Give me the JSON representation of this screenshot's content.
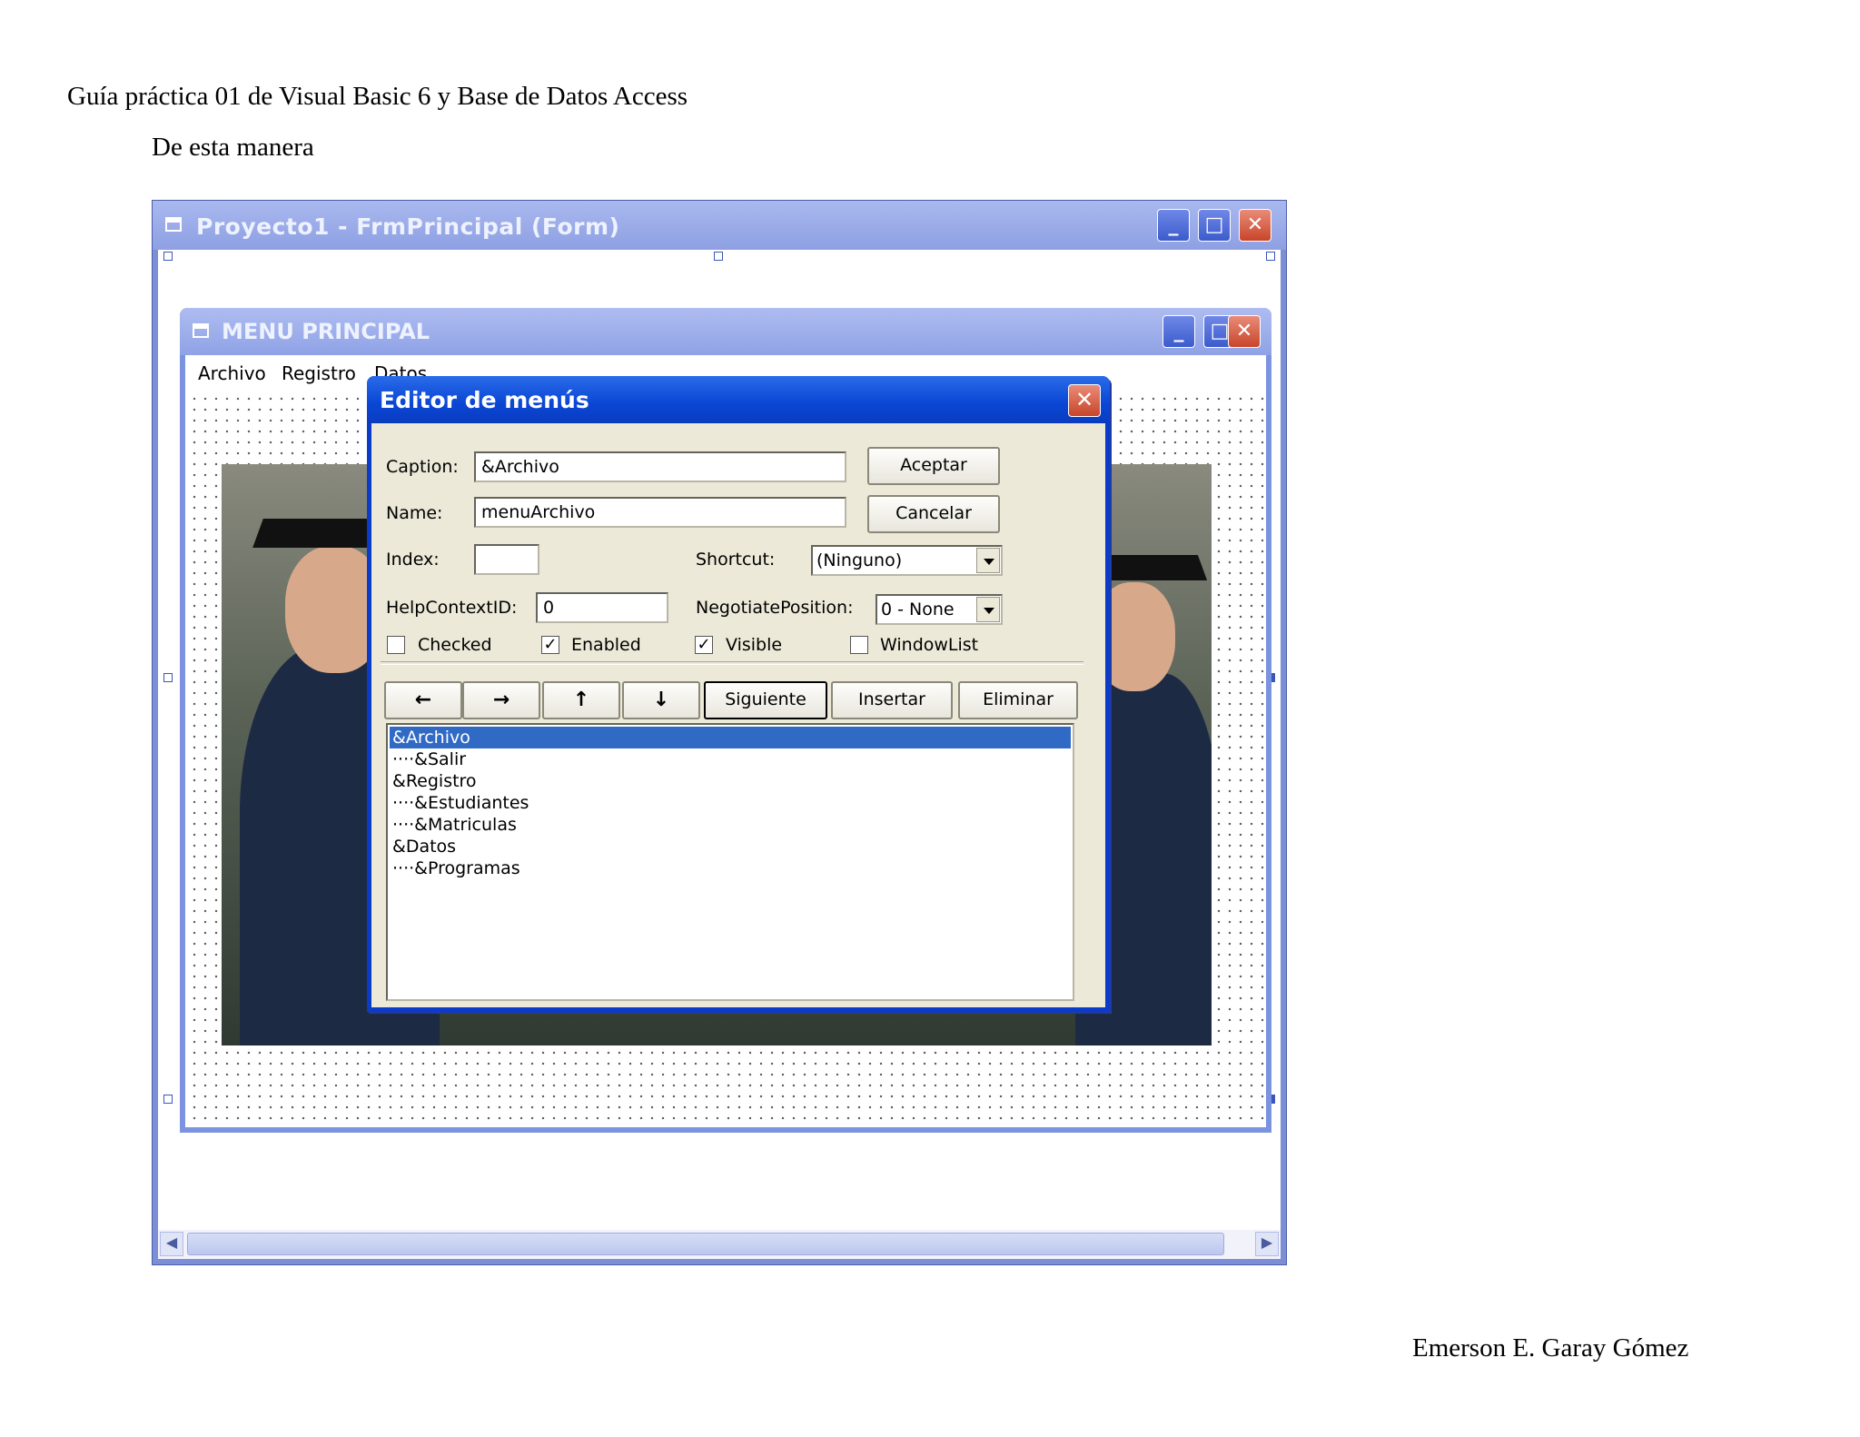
{
  "document": {
    "header": "Guía práctica 01 de Visual Basic 6 y Base de Datos Access",
    "subtitle": "De esta manera",
    "author": "Emerson E. Garay Gómez"
  },
  "ide_window": {
    "title": "Proyecto1 - FrmPrincipal (Form)",
    "buttons": [
      "minimize-icon",
      "maximize-icon",
      "close-icon"
    ]
  },
  "form_window": {
    "title": "MENU PRINCIPAL",
    "menu": [
      "Archivo",
      "Registro",
      "Datos"
    ]
  },
  "menu_editor": {
    "title": "Editor de menús",
    "caption_label": "Caption:",
    "caption_value": "&Archivo",
    "name_label": "Name:",
    "name_value": "menuArchivo",
    "index_label": "Index:",
    "index_value": "",
    "shortcut_label": "Shortcut:",
    "shortcut_value": "(Ninguno)",
    "helpcontext_label": "HelpContextID:",
    "helpcontext_value": "0",
    "negotiate_label": "NegotiatePosition:",
    "negotiate_value": "0 - None",
    "accept": "Aceptar",
    "cancel": "Cancelar",
    "checkboxes": [
      {
        "label": "Checked",
        "checked": false
      },
      {
        "label": "Enabled",
        "checked": true
      },
      {
        "label": "Visible",
        "checked": true
      },
      {
        "label": "WindowList",
        "checked": false
      }
    ],
    "arrow_buttons": [
      "arrow-left-icon",
      "arrow-right-icon",
      "arrow-up-icon",
      "arrow-down-icon"
    ],
    "next": "Siguiente",
    "insert": "Insertar",
    "delete": "Eliminar",
    "items": [
      "&Archivo",
      "····&Salir",
      "&Registro",
      "····&Estudiantes",
      "····&Matriculas",
      "&Datos",
      "····&Programas"
    ],
    "selected_index": 0
  },
  "colors": {
    "selection": "#316ac5",
    "dialog_title": "#0a46d4",
    "dialog_face": "#ece9d8"
  }
}
